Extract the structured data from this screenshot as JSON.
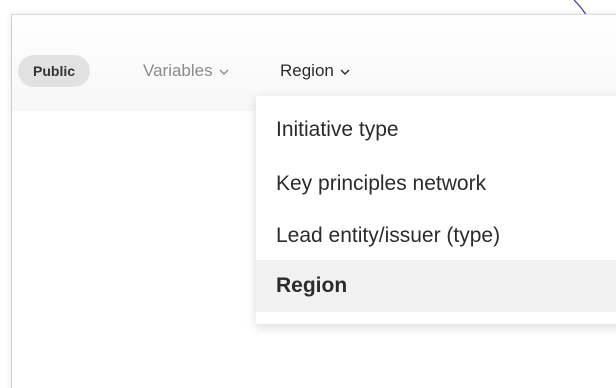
{
  "toolbar": {
    "badge_label": "Public",
    "filters": [
      {
        "label": "Variables",
        "icon": "chevron-down-icon"
      },
      {
        "label": "Region",
        "icon": "chevron-down-icon"
      }
    ]
  },
  "dropdown": {
    "items": [
      {
        "label": "Initiative type",
        "selected": false
      },
      {
        "label": "Key principles network",
        "selected": false
      },
      {
        "label": "Lead entity/issuer (type)",
        "selected": false
      },
      {
        "label": "Region",
        "selected": true
      }
    ]
  },
  "colors": {
    "badge_bg": "#e2e2e2",
    "muted_text": "#8a8a8a",
    "text": "#2b2b2b",
    "selected_bg": "#f2f2f2",
    "arc_stroke": "#3a3a9a"
  }
}
